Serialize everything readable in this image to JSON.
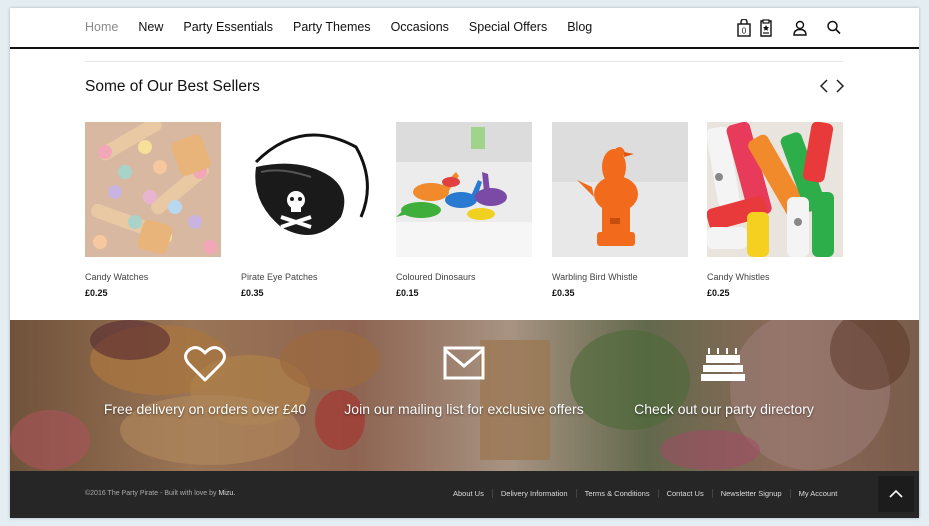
{
  "nav": {
    "items": [
      {
        "label": "Home"
      },
      {
        "label": "New"
      },
      {
        "label": "Party Essentials"
      },
      {
        "label": "Party Themes"
      },
      {
        "label": "Occasions"
      },
      {
        "label": "Special Offers"
      },
      {
        "label": "Blog"
      }
    ],
    "basket_count": "0",
    "icons": [
      "basket-icon",
      "wishlist-icon",
      "account-icon",
      "search-icon"
    ]
  },
  "best_sellers": {
    "title": "Some of Our Best Sellers",
    "products": [
      {
        "name": "Candy Watches",
        "price": "£0.25"
      },
      {
        "name": "Pirate Eye Patches",
        "price": "£0.35"
      },
      {
        "name": "Coloured Dinosaurs",
        "price": "£0.15"
      },
      {
        "name": "Warbling Bird Whistle",
        "price": "£0.35"
      },
      {
        "name": "Candy Whistles",
        "price": "£0.25"
      }
    ]
  },
  "features": [
    {
      "text": "Free delivery on orders over £40",
      "icon": "heart-icon"
    },
    {
      "text": "Join our mailing list for exclusive offers",
      "icon": "envelope-icon"
    },
    {
      "text": "Check out our party directory",
      "icon": "cake-icon"
    }
  ],
  "footer": {
    "copyright": "©2016 The Party Pirate - Built with love by",
    "credit": "Mizu.",
    "links": [
      {
        "label": "About Us"
      },
      {
        "label": "Delivery Information"
      },
      {
        "label": "Terms & Conditions"
      },
      {
        "label": "Contact Us"
      },
      {
        "label": "Newsletter Signup"
      },
      {
        "label": "My Account"
      }
    ]
  },
  "colors": {
    "text": "#111111",
    "nav_home": "#8a8a8a",
    "footer_bg": "#262626",
    "accent_orange": "#f26b1d"
  }
}
